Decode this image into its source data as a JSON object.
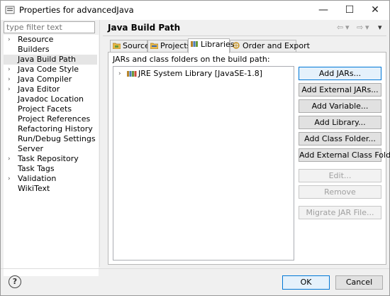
{
  "window": {
    "title": "Properties for advancedJava",
    "minimize_glyph": "—",
    "maximize_glyph": "☐",
    "close_glyph": "✕"
  },
  "sidebar": {
    "filter_placeholder": "type filter text",
    "items": [
      {
        "label": "Resource",
        "expandable": true
      },
      {
        "label": "Builders",
        "expandable": false
      },
      {
        "label": "Java Build Path",
        "expandable": false,
        "selected": true
      },
      {
        "label": "Java Code Style",
        "expandable": true
      },
      {
        "label": "Java Compiler",
        "expandable": true
      },
      {
        "label": "Java Editor",
        "expandable": true
      },
      {
        "label": "Javadoc Location",
        "expandable": false
      },
      {
        "label": "Project Facets",
        "expandable": false
      },
      {
        "label": "Project References",
        "expandable": false
      },
      {
        "label": "Refactoring History",
        "expandable": false
      },
      {
        "label": "Run/Debug Settings",
        "expandable": false
      },
      {
        "label": "Server",
        "expandable": false
      },
      {
        "label": "Task Repository",
        "expandable": true
      },
      {
        "label": "Task Tags",
        "expandable": false
      },
      {
        "label": "Validation",
        "expandable": true
      },
      {
        "label": "WikiText",
        "expandable": false
      }
    ]
  },
  "header": {
    "title": "Java Build Path",
    "back_glyph": "⇦",
    "forward_glyph": "⇨",
    "menu_glyph": "▾"
  },
  "tabs": [
    {
      "label": "Source",
      "icon": "source-folder-icon"
    },
    {
      "label": "Projects",
      "icon": "projects-icon"
    },
    {
      "label": "Libraries",
      "icon": "libraries-icon",
      "active": true
    },
    {
      "label": "Order and Export",
      "icon": "order-export-icon"
    }
  ],
  "libraries": {
    "list_label": "JARs and class folders on the build path:",
    "entries": [
      {
        "label": "JRE System Library [JavaSE-1.8]",
        "icon": "library-icon"
      }
    ]
  },
  "buttons": {
    "add_jars": "Add JARs...",
    "add_external_jars": "Add External JARs...",
    "add_variable": "Add Variable...",
    "add_library": "Add Library...",
    "add_class_folder": "Add Class Folder...",
    "add_external_class_folder": "Add External Class Folder...",
    "edit": "Edit...",
    "remove": "Remove",
    "migrate_jar": "Migrate JAR File..."
  },
  "footer": {
    "help_glyph": "?",
    "ok": "OK",
    "cancel": "Cancel"
  },
  "colors": {
    "accent": "#0078d7",
    "selection": "#e5e5e5",
    "disabled_text": "#a0a0a0"
  }
}
